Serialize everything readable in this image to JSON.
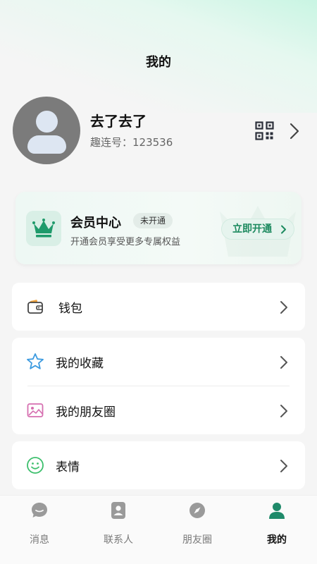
{
  "header": {
    "title": "我的"
  },
  "profile": {
    "nickname": "去了去了",
    "account_id": "趣连号：123536"
  },
  "member": {
    "title": "会员中心",
    "badge": "未开通",
    "description": "开通会员享受更多专属权益",
    "open_button": "立即开通",
    "accent_color": "#1d8a5f"
  },
  "menu": {
    "wallet": "钱包",
    "favorites": "我的收藏",
    "moments": "我的朋友圈",
    "stickers": "表情"
  },
  "tabs": [
    {
      "label": "消息",
      "icon": "chat-bubble-icon",
      "active": false
    },
    {
      "label": "联系人",
      "icon": "contacts-icon",
      "active": false
    },
    {
      "label": "朋友圈",
      "icon": "compass-icon",
      "active": false
    },
    {
      "label": "我的",
      "icon": "user-icon",
      "active": true
    }
  ]
}
